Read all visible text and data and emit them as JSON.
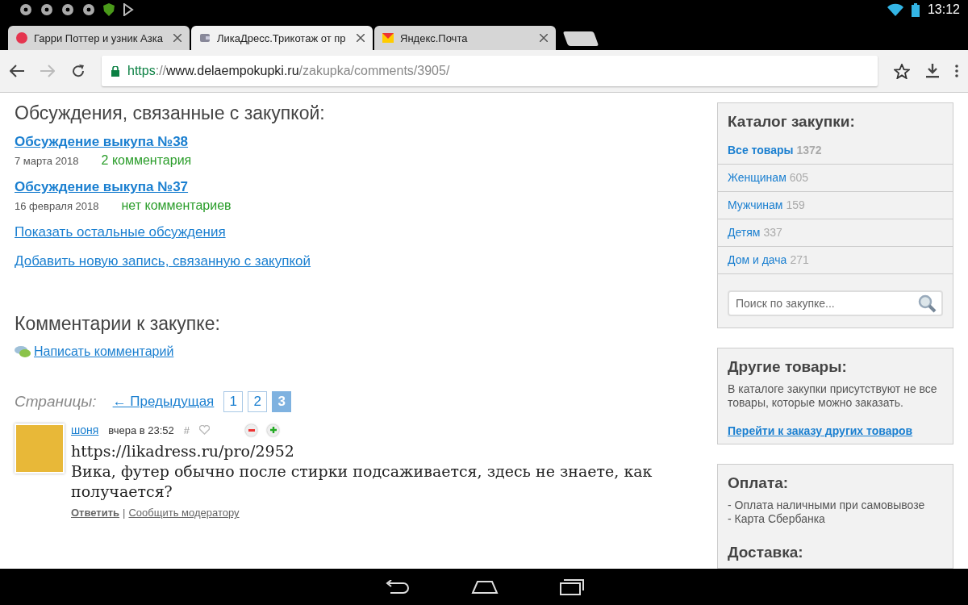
{
  "status_bar": {
    "time": "13:12"
  },
  "tabs": [
    {
      "title": "Гарри Поттер и узник Азка",
      "kind": "red",
      "selected": false
    },
    {
      "title": "ЛикаДресс.Трикотаж от пр",
      "kind": "wallet",
      "selected": true
    },
    {
      "title": "Яндекс.Почта",
      "kind": "mail",
      "selected": false
    }
  ],
  "address_bar": {
    "scheme": "https",
    "separator": "://",
    "host": "www.delaempokupki.ru",
    "path": "/zakupka/comments/3905/"
  },
  "discussions": {
    "heading": "Обсуждения, связанные с закупкой:",
    "items": [
      {
        "title": "Обсуждение выкупа №38",
        "date": "7 марта 2018",
        "comments": "2 комментария"
      },
      {
        "title": "Обсуждение выкупа №37",
        "date": "16 февраля 2018",
        "comments": "нет комментариев"
      }
    ],
    "show_more": "Показать остальные обсуждения",
    "add_new": "Добавить новую запись, связанную с закупкой"
  },
  "comments_section": {
    "heading": "Комментарии к закупке:",
    "write_link": "Написать комментарий",
    "pages_label": "Страницы:",
    "prev_link": "← Предыдущая",
    "pages": [
      {
        "label": "1",
        "selected": false
      },
      {
        "label": "2",
        "selected": false
      },
      {
        "label": "3",
        "selected": true
      }
    ],
    "comments": [
      {
        "author": "шоня",
        "time": "вчера в 23:52",
        "hash": "#",
        "link": "https://likadress.ru/pro/2952",
        "text": "Вика, футер обычно после стирки подсаживается, здесь не знаете, как получается?",
        "reply": "Ответить",
        "separator": "|",
        "report": "Сообщить модератору"
      }
    ]
  },
  "sidebar": {
    "catalog": {
      "heading": "Каталог закупки:",
      "items": [
        {
          "label": "Все товары",
          "count": "1372",
          "selected": true
        },
        {
          "label": "Женщинам",
          "count": "605",
          "selected": false
        },
        {
          "label": "Мужчинам",
          "count": "159",
          "selected": false
        },
        {
          "label": "Детям",
          "count": "337",
          "selected": false
        },
        {
          "label": "Дом и дача",
          "count": "271",
          "selected": false
        }
      ],
      "search_placeholder": "Поиск по закупке..."
    },
    "other": {
      "heading": "Другие товары:",
      "text": "В каталоге закупки присутствуют не все товары, которые можно заказать.",
      "link": "Перейти к заказу других товаров"
    },
    "payment": {
      "heading": "Оплата:",
      "lines": [
        "- Оплата наличными при самовывозе",
        "- Карта Сбербанка"
      ]
    },
    "delivery": {
      "heading": "Доставка:"
    }
  }
}
